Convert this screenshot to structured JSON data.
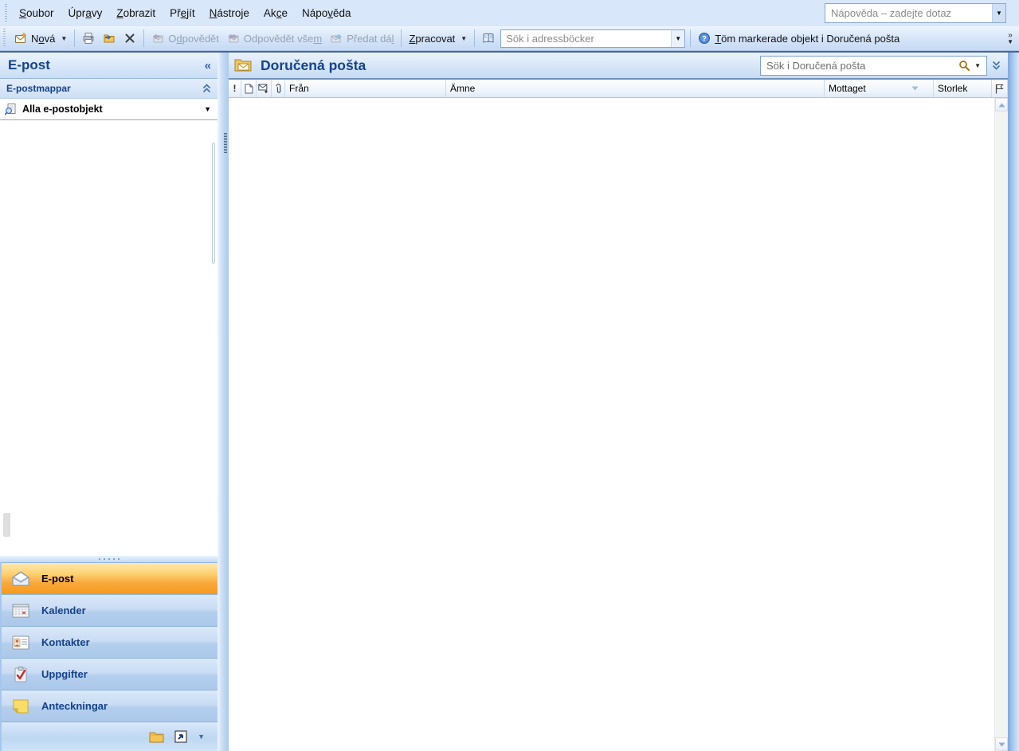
{
  "colors": {
    "accent_blue": "#15428b",
    "selected_orange": "#f69a1d",
    "pane_blue": "#c9def5",
    "disabled_text": "#96a3b4"
  },
  "glyphs": {
    "collapse": "«",
    "dropdown": "▼",
    "overflow": "»",
    "importance": "!"
  },
  "menu_bar": {
    "items": [
      {
        "pre": "",
        "u": "S",
        "post": "oubor"
      },
      {
        "pre": "Úpr",
        "u": "a",
        "post": "vy"
      },
      {
        "pre": "",
        "u": "Z",
        "post": "obrazit"
      },
      {
        "pre": "Př",
        "u": "e",
        "post": "jít"
      },
      {
        "pre": "",
        "u": "N",
        "post": "ástroje"
      },
      {
        "pre": "Ak",
        "u": "c",
        "post": "e"
      },
      {
        "pre": "Nápo",
        "u": "v",
        "post": "ěda"
      }
    ],
    "help_placeholder": "Nápověda – zadejte dotaz"
  },
  "toolbar": {
    "new": {
      "pre": "N",
      "u": "o",
      "post": "vá"
    },
    "reply": {
      "pre": "O",
      "u": "d",
      "post": "povědět"
    },
    "reply_all": {
      "pre": "Odpovědět vše",
      "u": "m",
      "post": ""
    },
    "forward": {
      "pre": "Předat dá",
      "u": "l",
      "post": ""
    },
    "process": {
      "pre": "",
      "u": "Z",
      "post": "pracovat"
    },
    "address_search_placeholder": "Sök i adressböcker",
    "empty_folder": {
      "pre": "",
      "u": "T",
      "post": "öm markerade objekt i Doručená pošta"
    }
  },
  "nav_pane": {
    "title": "E-post",
    "folders_header": "E-postmappar",
    "all_items": "Alla e-postobjekt",
    "buttons": [
      {
        "label": "E-post",
        "selected": true
      },
      {
        "label": "Kalender",
        "selected": false
      },
      {
        "label": "Kontakter",
        "selected": false
      },
      {
        "label": "Uppgifter",
        "selected": false
      },
      {
        "label": "Anteckningar",
        "selected": false
      }
    ]
  },
  "main": {
    "title": "Doručená pošta",
    "search_placeholder": "Sök i Doručená pošta",
    "columns": {
      "from": "Från",
      "subject": "Ämne",
      "received": "Mottaget",
      "size": "Storlek"
    },
    "rows": []
  }
}
